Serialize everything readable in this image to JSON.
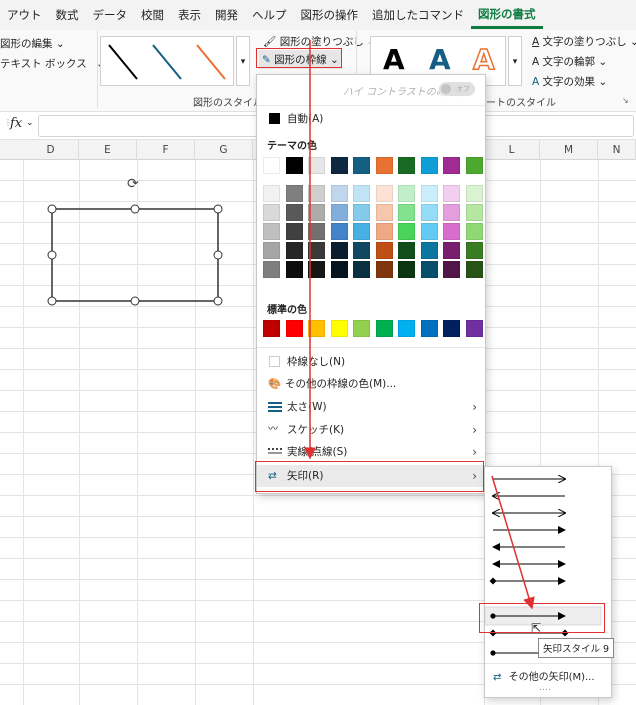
{
  "ribbon": {
    "tabs": [
      "アウト",
      "数式",
      "データ",
      "校閲",
      "表示",
      "開発",
      "ヘルプ",
      "図形の操作",
      "追加したコマンド",
      "図形の書式"
    ],
    "active_tab": "図形の書式",
    "edit_shape": "図形の編集 ⌄",
    "text_box": "テキスト ボックス",
    "shape_fill": "図形の塗りつぶし ⌄",
    "shape_outline": "図形の枠線 ⌄",
    "shape_styles_label": "図形のスタイル",
    "wordart_letter": "A",
    "text_fill": "文字の塗りつぶし ⌄",
    "text_outline": "文字の輪郭 ⌄",
    "text_effects": "文字の効果 ⌄",
    "wordart_styles_label": "ートのスタイル"
  },
  "formula_bar": {
    "fx": "fx"
  },
  "columns": [
    "D",
    "E",
    "F",
    "G",
    "L",
    "M",
    "N"
  ],
  "menu": {
    "high_contrast": "ハイ コントラストのみ(H)",
    "toggle_state": "オフ",
    "auto": "自動(A)",
    "theme_colors_label": "テーマの色",
    "standard_colors_label": "標準の色",
    "no_outline": "枠線なし(N)",
    "more_colors": "その他の枠線の色(M)...",
    "weight": "太さ(W)",
    "sketch": "スケッチ(K)",
    "dashes": "実線/点線(S)",
    "arrows": "矢印(R)"
  },
  "theme_colors_top": [
    "#ffffff",
    "#000000",
    "#e7e6e6",
    "#0e2841",
    "#156082",
    "#e97132",
    "#196b24",
    "#0f9ed5",
    "#a02b93",
    "#4ea72e"
  ],
  "theme_colors_shades": [
    [
      "#f2f2f2",
      "#7f7f7f",
      "#d0cece",
      "#c0d6ec",
      "#c1e4f5",
      "#fbe2d5",
      "#c1f0c8",
      "#caeefb",
      "#f2ceef",
      "#d9f2d0"
    ],
    [
      "#d9d9d9",
      "#595959",
      "#aeabab",
      "#82aedc",
      "#83caeb",
      "#f7c7ac",
      "#83e28e",
      "#95dcf7",
      "#e49edd",
      "#b5e6a2"
    ],
    [
      "#bfbfbf",
      "#404040",
      "#757070",
      "#4383c7",
      "#45b0e1",
      "#f1a983",
      "#47d459",
      "#61cbf3",
      "#d86dcd",
      "#8ed973"
    ],
    [
      "#a6a6a6",
      "#262626",
      "#3a3838",
      "#0a1e30",
      "#104861",
      "#c04f15",
      "#124f1a",
      "#0b76a0",
      "#78206e",
      "#3a7c22"
    ],
    [
      "#7f7f7f",
      "#0d0d0d",
      "#171616",
      "#061420",
      "#0a3041",
      "#7f350e",
      "#0c3512",
      "#074f6a",
      "#501549",
      "#275317"
    ]
  ],
  "standard_colors": [
    "#c00000",
    "#ff0000",
    "#ffc000",
    "#ffff00",
    "#92d050",
    "#00b050",
    "#00b0f0",
    "#0070c0",
    "#002060",
    "#7030a0"
  ],
  "submenu": {
    "tooltip": "矢印スタイル 9",
    "more_arrows": "その他の矢印(M)...",
    "styles": [
      "→",
      "←",
      "↔",
      "⇥",
      "⇤",
      "⟷",
      "◆⇥",
      "●→",
      "◆◆",
      "●●"
    ]
  }
}
